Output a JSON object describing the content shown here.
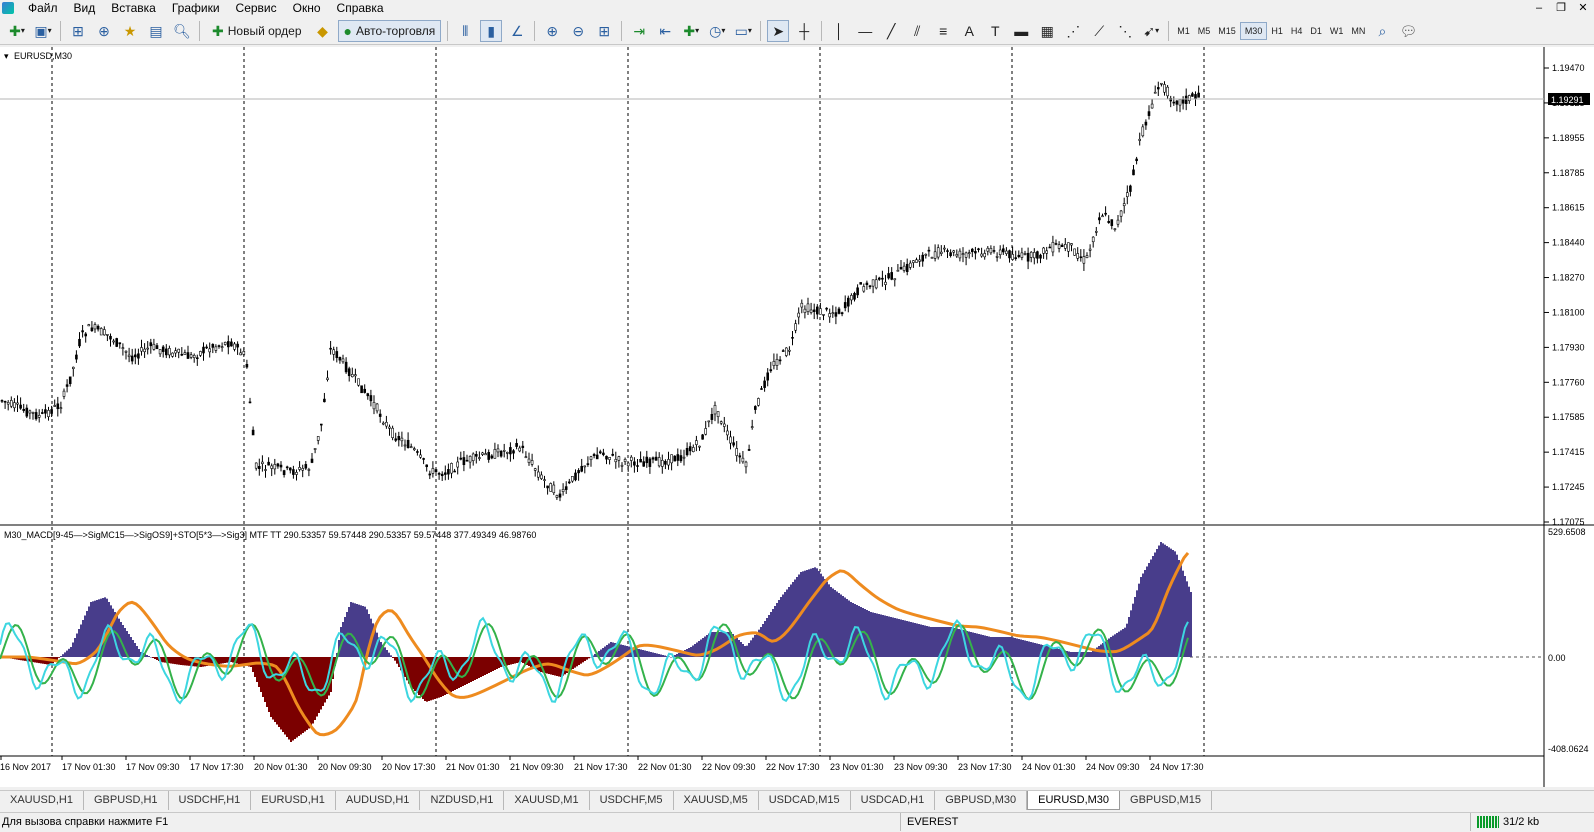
{
  "menu": [
    "Файл",
    "Вид",
    "Вставка",
    "Графики",
    "Сервис",
    "Окно",
    "Справка"
  ],
  "toolbar": {
    "new_order_label": "Новый ордер",
    "autotrading_label": "Авто-торговля",
    "timeframes": [
      "M1",
      "M5",
      "M15",
      "M30",
      "H1",
      "H4",
      "D1",
      "W1",
      "MN"
    ],
    "active_timeframe": "M30"
  },
  "chart": {
    "symbol_label": "EURUSD,M30",
    "price_levels": [
      "1.19470",
      "1.19125",
      "1.18955",
      "1.18785",
      "1.18615",
      "1.18440",
      "1.18270",
      "1.18100",
      "1.17930",
      "1.17760",
      "1.17585",
      "1.17415",
      "1.17245",
      "1.17075"
    ],
    "current_price": "1.19291",
    "time_labels": [
      "16 Nov 2017",
      "17 Nov 01:30",
      "17 Nov 09:30",
      "17 Nov 17:30",
      "20 Nov 01:30",
      "20 Nov 09:30",
      "20 Nov 17:30",
      "21 Nov 01:30",
      "21 Nov 09:30",
      "21 Nov 17:30",
      "22 Nov 01:30",
      "22 Nov 09:30",
      "22 Nov 17:30",
      "23 Nov 01:30",
      "23 Nov 09:30",
      "23 Nov 17:30",
      "24 Nov 01:30",
      "24 Nov 09:30",
      "24 Nov 17:30"
    ],
    "indicator_label": "M30_MACD[9-45—>SigMC15—>SigOS9]+STO[5*3—>Sig3] MTF TT 290.53357 59.57448 290.53357 59.57448 377.49349 46.98760",
    "indicator_levels": [
      "529.6508",
      "0.00",
      "-408.0624"
    ],
    "colors": {
      "histogram_positive": "#483d8b",
      "histogram_negative": "#7b0000",
      "signal_line": "#ee8b1f",
      "stoch_main": "#3dd6e0",
      "stoch_signal": "#34b24a",
      "candle": "#000000"
    }
  },
  "tabs": [
    "XAUUSD,H1",
    "GBPUSD,H1",
    "USDCHF,H1",
    "EURUSD,H1",
    "AUDUSD,H1",
    "NZDUSD,H1",
    "XAUUSD,M1",
    "USDCHF,M5",
    "XAUUSD,M5",
    "USDCAD,M15",
    "USDCAD,H1",
    "GBPUSD,M30",
    "EURUSD,M30",
    "GBPUSD,M15"
  ],
  "active_tab": "EURUSD,M30",
  "status": {
    "help": "Для вызова справки нажмите F1",
    "profile": "EVEREST",
    "traffic": "31/2 kb"
  }
}
